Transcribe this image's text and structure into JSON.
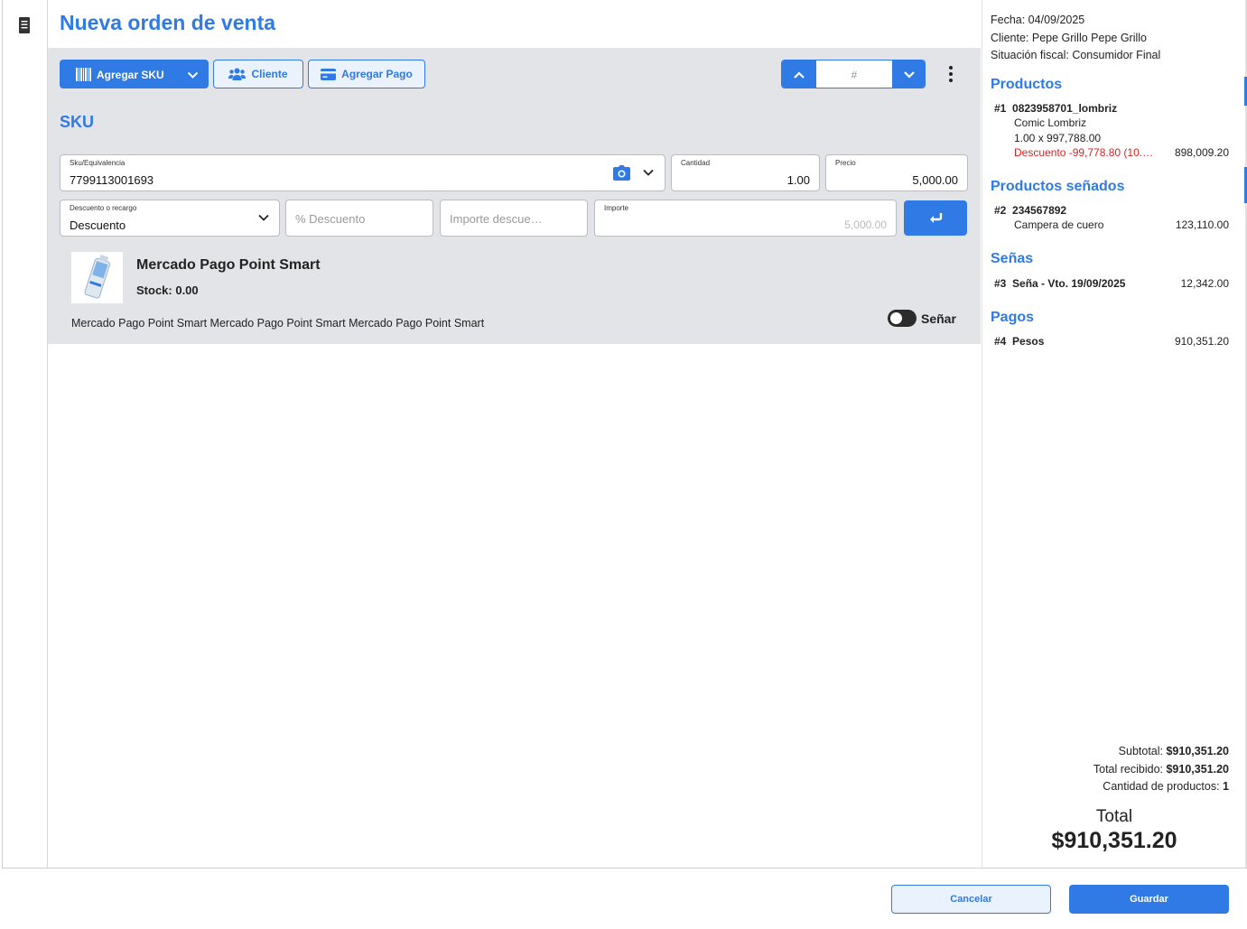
{
  "window": {
    "title": "Nueva orden de venta"
  },
  "toolbar": {
    "add_sku_label": "Agregar SKU",
    "client_label": "Cliente",
    "add_payment_label": "Agregar Pago",
    "nav_placeholder": "#"
  },
  "sku_section": {
    "title": "SKU",
    "sku_field": {
      "label": "Sku/Equivalencia",
      "value": "7799113001693"
    },
    "quantity_field": {
      "label": "Cantidad",
      "value": "1.00"
    },
    "price_field": {
      "label": "Precio",
      "value": "5,000.00"
    },
    "discount_type_field": {
      "label": "Descuento o recargo",
      "value": "Descuento"
    },
    "discount_percent_field": {
      "placeholder": "% Descuento"
    },
    "discount_amount_field": {
      "placeholder": "Importe descue…"
    },
    "amount_field": {
      "label": "Importe",
      "value": "5,000.00"
    }
  },
  "product": {
    "name": "Mercado Pago Point Smart",
    "stock": "Stock: 0.00",
    "description": "Mercado Pago Point Smart Mercado Pago Point Smart Mercado Pago Point Smart",
    "toggle_label": "Señar",
    "toggle_on": false
  },
  "sidebar": {
    "date": "Fecha: 04/09/2025",
    "client": "Cliente: Pepe Grillo Pepe Grillo",
    "tax_status": "Situación fiscal: Consumidor Final",
    "products_title": "Productos",
    "products": [
      {
        "index": "#1",
        "code": "0823958701_lombriz",
        "name": "Comic Lombriz",
        "qty_price": "1.00 x 997,788.00",
        "discount": "Descuento -99,778.80 (10.…",
        "total": "898,009.20"
      }
    ],
    "reserved_title": "Productos señados",
    "reserved": [
      {
        "index": "#2",
        "code": "234567892",
        "name": "Campera de cuero",
        "total": "123,110.00"
      }
    ],
    "deposits_title": "Señas",
    "deposits": [
      {
        "index": "#3",
        "label": "Seña - Vto. 19/09/2025",
        "total": "12,342.00"
      }
    ],
    "payments_title": "Pagos",
    "payments": [
      {
        "index": "#4",
        "label": "Pesos",
        "total": "910,351.20"
      }
    ]
  },
  "totals": {
    "subtotal_label": "Subtotal:",
    "subtotal_value": "$910,351.20",
    "received_label": "Total recibido:",
    "received_value": "$910,351.20",
    "count_label": "Cantidad de productos:",
    "count_value": "1",
    "total_label": "Total",
    "total_value": "$910,351.20"
  },
  "footer": {
    "cancel_label": "Cancelar",
    "save_label": "Guardar"
  },
  "colors": {
    "accent": "#2f7ae5",
    "panel": "#e3e4e8",
    "discount": "#e01e1e"
  }
}
